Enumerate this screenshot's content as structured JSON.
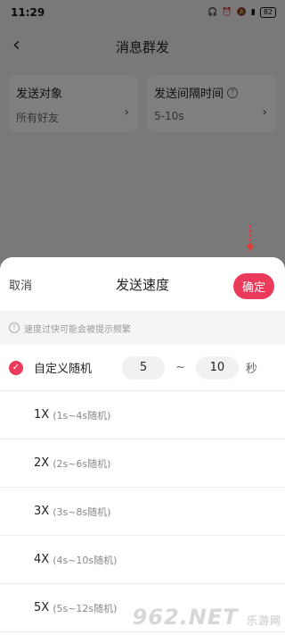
{
  "status": {
    "time": "11:29",
    "battery": "82"
  },
  "header": {
    "title": "消息群发"
  },
  "cards": [
    {
      "label": "发送对象",
      "value": "所有好友"
    },
    {
      "label": "发送间隔时间",
      "value": "5-10s"
    }
  ],
  "sheet": {
    "cancel": "取消",
    "title": "发送速度",
    "confirm": "确定",
    "tip": "速度过快可能会被提示频繁",
    "custom": {
      "label": "自定义随机",
      "min": "5",
      "max": "10",
      "tilde": "~",
      "unit": "秒"
    },
    "options": [
      {
        "label": "1X",
        "sub": "(1s~4s随机)"
      },
      {
        "label": "2X",
        "sub": "(2s~6s随机)"
      },
      {
        "label": "3X",
        "sub": "(3s~8s随机)"
      },
      {
        "label": "4X",
        "sub": "(4s~10s随机)"
      },
      {
        "label": "5X",
        "sub": "(5s~12s随机)"
      }
    ]
  },
  "watermark": {
    "brand": "962.NET",
    "sub": "乐游网"
  },
  "colors": {
    "accent": "#ec3a5b",
    "overlay": "rgba(0,0,0,0.5)"
  }
}
